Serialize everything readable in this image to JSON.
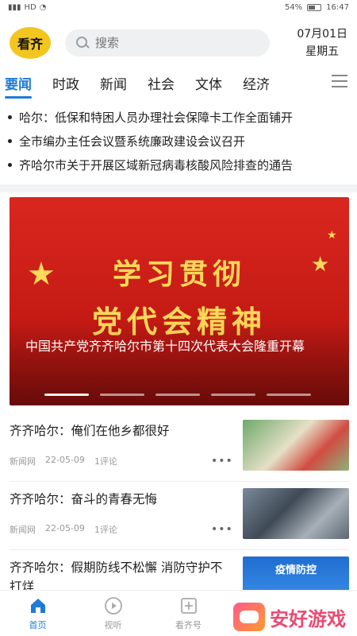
{
  "status_bar": {
    "signal": "HD",
    "battery": "54%",
    "time": "16:47"
  },
  "header": {
    "logo_text": "看齐",
    "search_placeholder": "搜索",
    "date": "07月01日",
    "weekday": "星期五"
  },
  "tabs": [
    {
      "label": "要闻",
      "active": true
    },
    {
      "label": "时政"
    },
    {
      "label": "新闻"
    },
    {
      "label": "社会"
    },
    {
      "label": "文体"
    },
    {
      "label": "经济"
    }
  ],
  "headlines": [
    "哈尔：低保和特困人员办理社会保障卡工作全面铺开",
    "全市编办主任会议暨系统廉政建设会议召开",
    "齐哈尔市关于开展区域新冠病毒核酸风险排查的通告"
  ],
  "banner": {
    "line1": "学习贯彻",
    "line2": "党代会精神",
    "caption": "中国共产党齐齐哈尔市第十四次代表大会隆重开幕",
    "slide_count": 5,
    "active_slide": 1
  },
  "news": [
    {
      "title": "齐齐哈尔：俺们在他乡都很好",
      "source": "新闻网",
      "date": "22-05-09",
      "comments": "1评论",
      "more": "•••"
    },
    {
      "title": "齐齐哈尔：奋斗的青春无悔",
      "source": "新闻网",
      "date": "22-05-09",
      "comments": "1评论",
      "more": "•••"
    },
    {
      "title": "齐齐哈尔：假期防线不松懈 消防守护不打烊",
      "thumb_text": "疫情防控"
    }
  ],
  "bottom_nav": [
    {
      "label": "首页",
      "icon": "home-icon",
      "active": true
    },
    {
      "label": "视听",
      "icon": "play-icon"
    },
    {
      "label": "看齐号",
      "icon": "plus-square-icon"
    }
  ],
  "watermark": {
    "text": "安好游戏"
  },
  "colors": {
    "accent": "#1e7bd8",
    "banner_red": "#d9271f",
    "banner_gold": "#ffd95a",
    "logo_yellow": "#f3c51f"
  }
}
